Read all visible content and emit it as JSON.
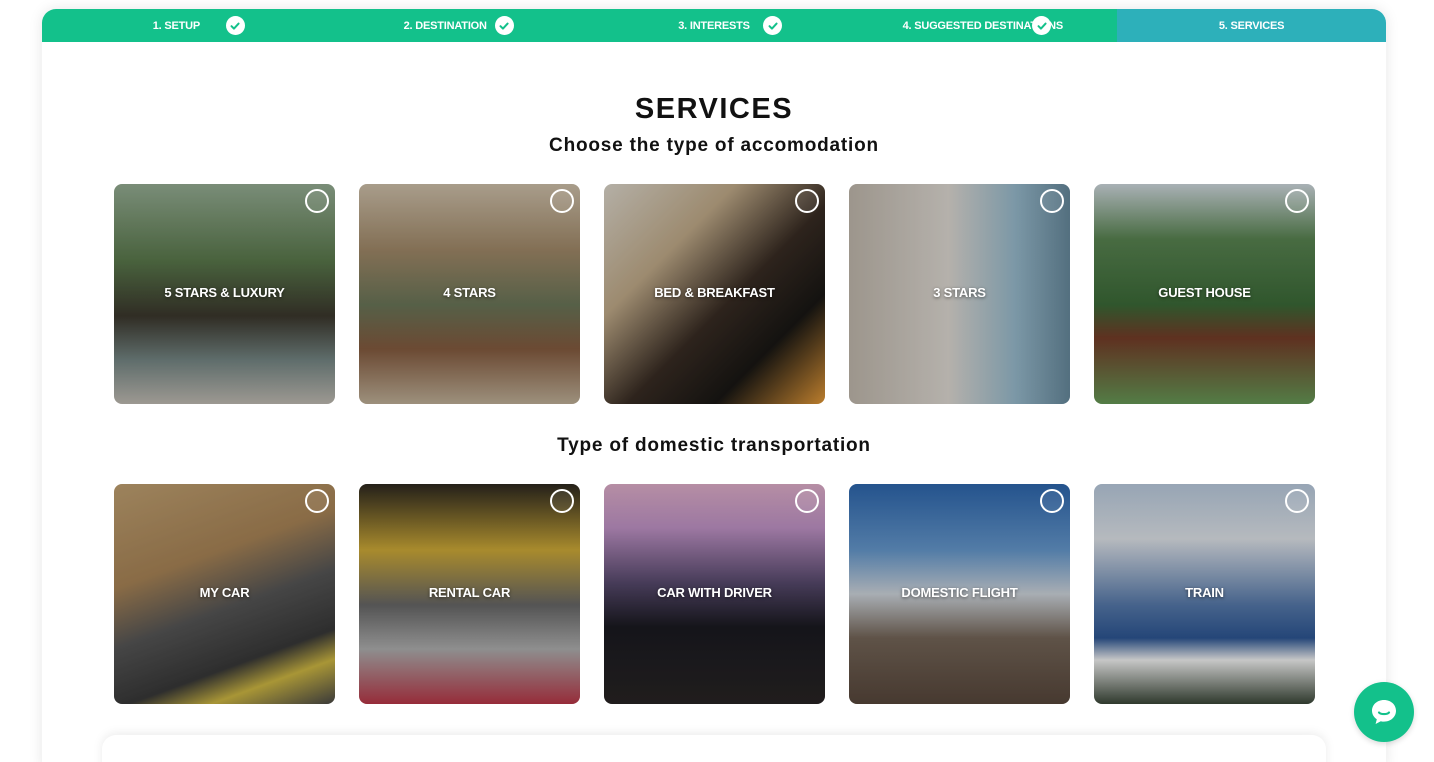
{
  "steps": [
    {
      "label": "1. SETUP",
      "done": true
    },
    {
      "label": "2. DESTINATION",
      "done": true
    },
    {
      "label": "3. INTERESTS",
      "done": true
    },
    {
      "label": "4. SUGGESTED DESTINATIONS",
      "done": true
    },
    {
      "label": "5. SERVICES",
      "done": false
    }
  ],
  "colors": {
    "step_done": "#13c18b",
    "step_active": "#2db0ba",
    "chat": "#13c18b"
  },
  "page": {
    "title": "SERVICES",
    "accommodation_heading": "Choose the type of accomodation",
    "transport_heading": "Type of domestic transportation"
  },
  "accommodation": [
    {
      "label": "5 STARS & LUXURY",
      "selected": false
    },
    {
      "label": "4 STARS",
      "selected": false
    },
    {
      "label": "BED & BREAKFAST",
      "selected": false
    },
    {
      "label": "3 STARS",
      "selected": false
    },
    {
      "label": "GUEST HOUSE",
      "selected": false
    }
  ],
  "transport": [
    {
      "label": "MY CAR",
      "selected": false
    },
    {
      "label": "RENTAL CAR",
      "selected": false
    },
    {
      "label": "CAR WITH DRIVER",
      "selected": false
    },
    {
      "label": "DOMESTIC FLIGHT",
      "selected": false
    },
    {
      "label": "TRAIN",
      "selected": false
    }
  ],
  "icons": {
    "step_done": "check-circle-icon",
    "chat": "chat-bubble-icon",
    "card_select": "radio-icon"
  }
}
